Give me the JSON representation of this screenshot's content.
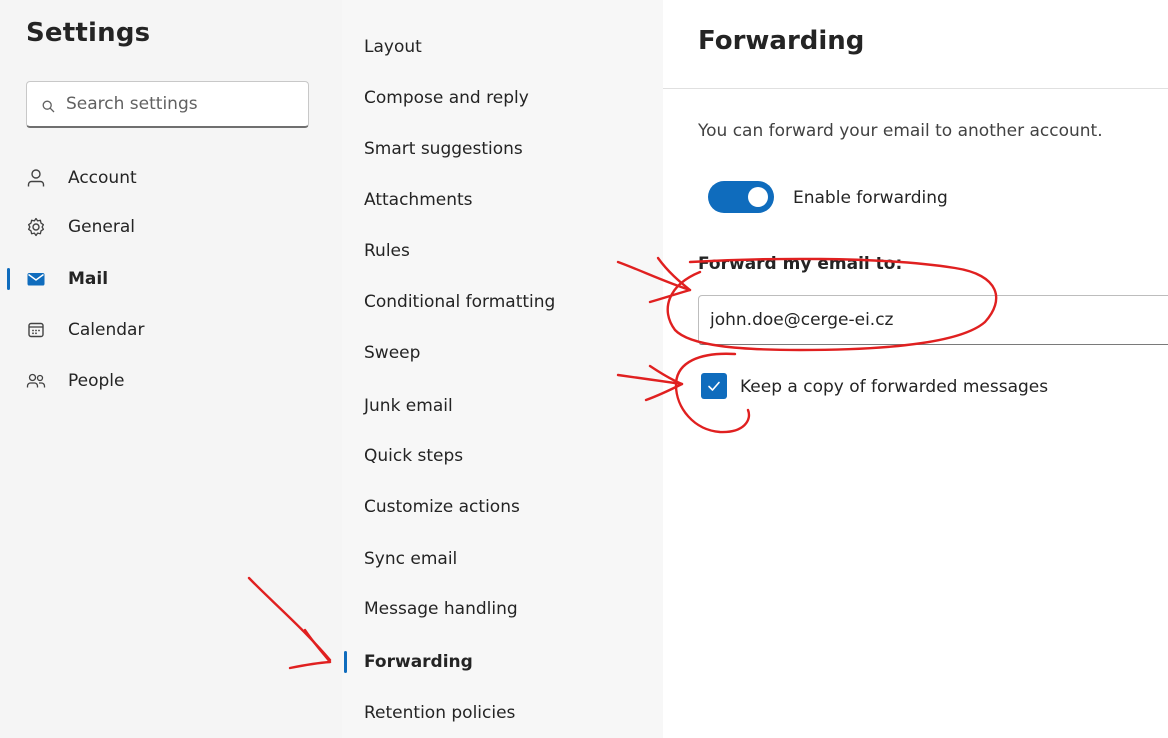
{
  "settings": {
    "title": "Settings",
    "search_placeholder": "Search settings"
  },
  "primary_nav": [
    {
      "label": "Account",
      "icon": "person-icon"
    },
    {
      "label": "General",
      "icon": "gear-icon"
    },
    {
      "label": "Mail",
      "icon": "mail-icon",
      "active": true
    },
    {
      "label": "Calendar",
      "icon": "calendar-icon"
    },
    {
      "label": "People",
      "icon": "people-icon"
    }
  ],
  "mail_nav": [
    {
      "label": "Layout"
    },
    {
      "label": "Compose and reply"
    },
    {
      "label": "Smart suggestions"
    },
    {
      "label": "Attachments"
    },
    {
      "label": "Rules"
    },
    {
      "label": "Conditional formatting"
    },
    {
      "label": "Sweep"
    },
    {
      "label": "Junk email"
    },
    {
      "label": "Quick steps"
    },
    {
      "label": "Customize actions"
    },
    {
      "label": "Sync email"
    },
    {
      "label": "Message handling"
    },
    {
      "label": "Forwarding",
      "active": true
    },
    {
      "label": "Retention policies"
    }
  ],
  "forwarding": {
    "title": "Forwarding",
    "description": "You can forward your email to another account.",
    "toggle_label": "Enable forwarding",
    "toggle_on": true,
    "field_label": "Forward my email to:",
    "email_value": "john.doe@cerge-ei.cz",
    "keep_copy_label": "Keep a copy of forwarded messages",
    "keep_copy_checked": true
  },
  "colors": {
    "accent": "#0f6cbd",
    "annotation": "#e02020"
  }
}
